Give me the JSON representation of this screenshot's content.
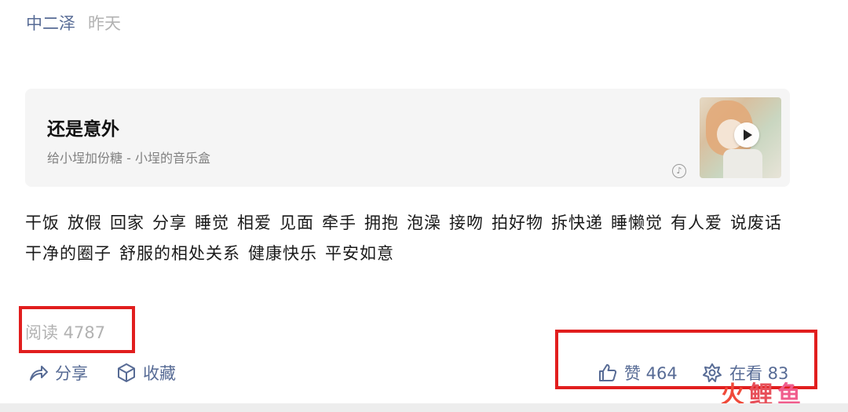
{
  "meta": {
    "author": "中二泽",
    "time": "昨天"
  },
  "music": {
    "title": "还是意外",
    "subtitle": "给小埕加份糖 - 小埕的音乐盒"
  },
  "tags": [
    "干饭",
    "放假",
    "回家",
    "分享",
    "睡觉",
    "相爱",
    "见面",
    "牵手",
    "拥抱",
    "泡澡",
    "接吻",
    "拍好物",
    "拆快递",
    "睡懒觉",
    "有人爱",
    "说废话",
    "干净的圈子",
    "舒服的相处关系",
    "健康快乐",
    "平安如意"
  ],
  "stats": {
    "read": "阅读 4787"
  },
  "actions": {
    "share_label": "分享",
    "favorite_label": "收藏",
    "like_label": "赞 464",
    "looking_label": "在看 83"
  },
  "watermark": {
    "c1": "火",
    "c2": "鲤",
    "c3": "鱼"
  },
  "colors": {
    "link": "#576b95",
    "muted": "#b2b2b2",
    "highlight_box": "#e11e1e"
  }
}
